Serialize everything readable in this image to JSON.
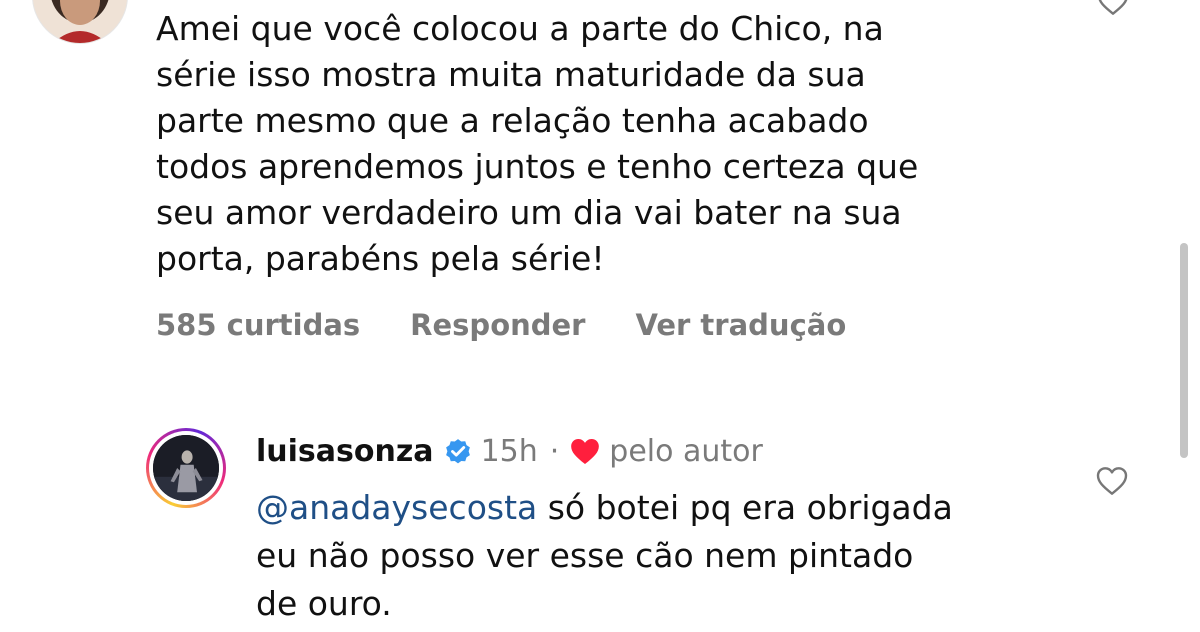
{
  "comment": {
    "text": "Amei que você colocou a parte do Chico, na\nsérie isso mostra muita maturidade da sua\nparte mesmo que a relação tenha acabado\ntodos aprendemos juntos e tenho certeza que\nseu amor verdadeiro um dia vai bater na sua\nporta, parabéns pela série!",
    "likes": "585 curtidas",
    "reply_label": "Responder",
    "translate_label": "Ver tradução",
    "like_icon": "heart-outline-icon"
  },
  "reply": {
    "username": "luisasonza",
    "verified_icon": "verified-badge-icon",
    "timestamp": "15h",
    "separator": "·",
    "liked_icon": "red-heart-icon",
    "by_author": "pelo autor",
    "mention": "@anadaysecosta",
    "text": " só botei pq era obrigada\neu não posso ver esse cão nem pintado\nde ouro.",
    "like_icon": "heart-outline-icon"
  },
  "colors": {
    "mention": "#1f4f86",
    "muted_text": "#7a7a7a",
    "verified": "#3797f0",
    "liked_heart": "#ff1f3d"
  }
}
